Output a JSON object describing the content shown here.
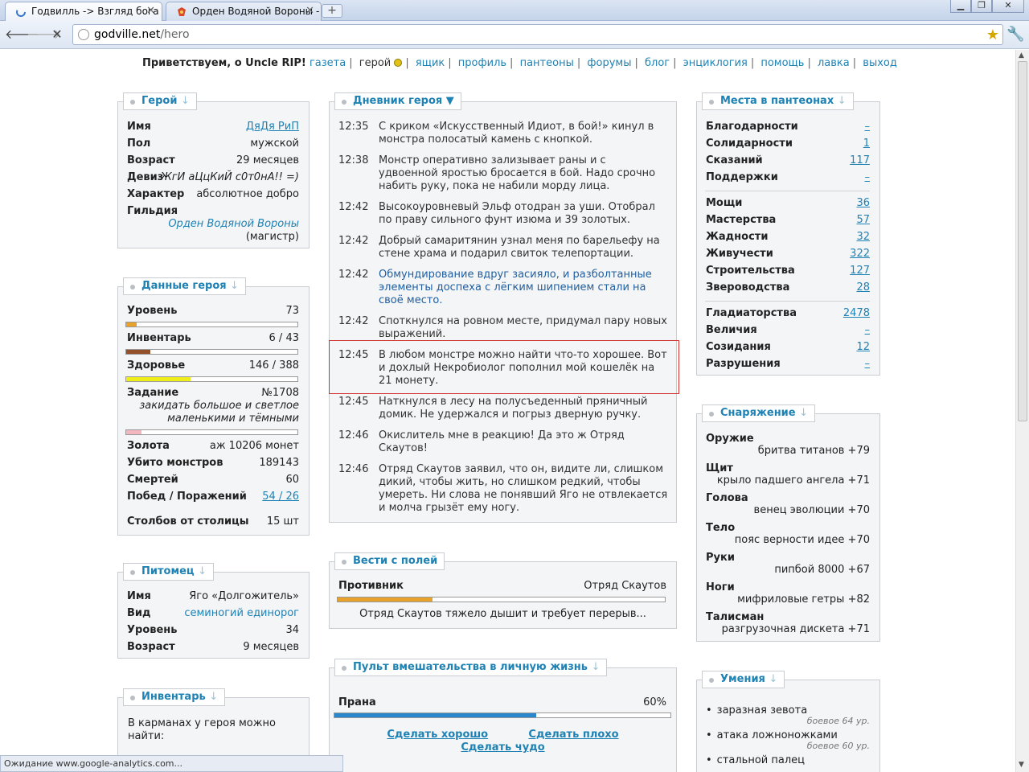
{
  "browser": {
    "tabs": [
      {
        "title": "Годвилль -> Взгляд бога"
      },
      {
        "title": "Орден Водяной Вороны - ..."
      }
    ],
    "url_host": "godville.net",
    "url_path": "/hero",
    "status": "Ожидание www.google-analytics.com..."
  },
  "menu": {
    "greeting": "Приветствуем, о Uncle RIP!",
    "items": [
      "газета",
      "герой",
      "ящик",
      "профиль",
      "пантеоны",
      "форумы",
      "блог",
      "энциклогия",
      "помощь",
      "лавка",
      "выход"
    ]
  },
  "hero": {
    "title": "Герой",
    "rows": [
      {
        "k": "Имя",
        "v": "ДяДя РиП"
      },
      {
        "k": "Пол",
        "v": "мужской"
      },
      {
        "k": "Возраст",
        "v": "29 месяцев"
      },
      {
        "k": "Девиз",
        "v": "ЖгИ аЦцКиЙ с0т0нА!! =)"
      },
      {
        "k": "Характер",
        "v": "абсолютное добро"
      },
      {
        "k": "Гильдия",
        "v": "Орден Водяной Вороны",
        "v2": "(магистр)"
      }
    ]
  },
  "stats": {
    "title": "Данные героя",
    "level_k": "Уровень",
    "level_v": "73",
    "level_pct": 0.06,
    "inv_k": "Инвентарь",
    "inv_v": "6 / 43",
    "inv_pct": 0.14,
    "hp_k": "Здоровье",
    "hp_v": "146 / 388",
    "hp_pct": 0.376,
    "quest_k": "Задание",
    "quest_v": "№1708",
    "quest_text": "закидать большое и светлое маленькими и тёмными",
    "quest_pct": 0.09,
    "gold_k": "Золота",
    "gold_v": "аж 10206 монет",
    "kills_k": "Убито монстров",
    "kills_v": "189143",
    "deaths_k": "Смертей",
    "deaths_v": "60",
    "wins_k": "Побед / Поражений",
    "wins_v": "54 / 26",
    "poles_k": "Столбов от столицы",
    "poles_v": "15 шт"
  },
  "pet": {
    "title": "Питомец",
    "rows": [
      {
        "k": "Имя",
        "v": "Яго «Долгожитель»"
      },
      {
        "k": "Вид",
        "v": "семиногий единорог"
      },
      {
        "k": "Уровень",
        "v": "34"
      },
      {
        "k": "Возраст",
        "v": "9 месяцев"
      }
    ]
  },
  "inventory": {
    "title": "Инвентарь",
    "text": "В карманах у героя можно найти:"
  },
  "diary": {
    "title": "Дневник героя ▼",
    "entries": [
      {
        "t": "12:35",
        "text": "С криком «Искусственный Идиот, в бой!» кинул в монстра полосатый камень с кнопкой."
      },
      {
        "t": "12:38",
        "text": "Монстр оперативно зализывает раны и с удвоенной яростью бросается в бой. Надо срочно набить руку, пока не набили морду лица."
      },
      {
        "t": "12:42",
        "text": "Высокоуровневый Эльф отодран за уши. Отобрал по праву сильного фунт изюма и 39 золотых."
      },
      {
        "t": "12:42",
        "text": "Добрый самаритянин узнал меня по барельефу на стене храма и подарил свиток телепортации."
      },
      {
        "t": "12:42",
        "text": "Обмундирование вдруг засияло, и разболтанные элементы доспеха с лёгким шипением стали на своё место."
      },
      {
        "t": "12:42",
        "text": "Споткнулся на ровном месте, придумал пару новых выражений."
      },
      {
        "t": "12:45",
        "text": "В любом монстре можно найти что-то хорошее. Вот и дохлый Некробиолог пополнил мой кошелёк на 21 монету."
      },
      {
        "t": "12:45",
        "text": "Наткнулся в лесу на полусъеденный пряничный домик. Не удержался и погрыз дверную ручку."
      },
      {
        "t": "12:46",
        "text": "Окислитель мне в реакцию! Да это ж Отряд Скаутов!"
      },
      {
        "t": "12:46",
        "text": "Отряд Скаутов заявил, что он, видите ли, слишком дикий, чтобы жить, но слишком редкий, чтобы умереть. Ни слова не понявший Яго не отвлекается и молча грызёт ему ногу."
      }
    ]
  },
  "news": {
    "title": "Вести с полей",
    "opp_k": "Противник",
    "opp_v": "Отряд Скаутов",
    "opp_pct": 0.29,
    "text": "Отряд Скаутов тяжело дышит и требует перерыв..."
  },
  "remote": {
    "title": "Пульт вмешательства в личную жизнь",
    "prana_k": "Прана",
    "prana_v": "60%",
    "prana_pct": 0.6,
    "good": "Сделать хорошо",
    "bad": "Сделать плохо",
    "miracle": "Сделать чудо"
  },
  "pantheons": {
    "title": "Места в пантеонах",
    "g1": [
      {
        "k": "Благодарности",
        "v": "–"
      },
      {
        "k": "Солидарности",
        "v": "1"
      },
      {
        "k": "Сказаний",
        "v": "117"
      },
      {
        "k": "Поддержки",
        "v": "–"
      }
    ],
    "g2": [
      {
        "k": "Мощи",
        "v": "36"
      },
      {
        "k": "Мастерства",
        "v": "57"
      },
      {
        "k": "Жадности",
        "v": "32"
      },
      {
        "k": "Живучести",
        "v": "322"
      },
      {
        "k": "Строительства",
        "v": "127"
      },
      {
        "k": "Звероводства",
        "v": "28"
      }
    ],
    "g3": [
      {
        "k": "Гладиаторства",
        "v": "2478"
      },
      {
        "k": "Величия",
        "v": "–"
      },
      {
        "k": "Созидания",
        "v": "12"
      },
      {
        "k": "Разрушения",
        "v": "–"
      }
    ]
  },
  "equip": {
    "title": "Снаряжение",
    "items": [
      {
        "k": "Оружие",
        "v": "бритва титанов +79"
      },
      {
        "k": "Щит",
        "v": "крыло падшего ангела +71"
      },
      {
        "k": "Голова",
        "v": "венец эволюции +70"
      },
      {
        "k": "Тело",
        "v": "пояс верности идее +70"
      },
      {
        "k": "Руки",
        "v": "пипбой 8000 +67"
      },
      {
        "k": "Ноги",
        "v": "мифриловые гетры +82"
      },
      {
        "k": "Талисман",
        "v": "разгрузочная дискета +71"
      }
    ]
  },
  "skills": {
    "title": "Умения",
    "items": [
      {
        "name": "заразная зевота",
        "lvl": "боевое 64 ур."
      },
      {
        "name": "атака ложноножками",
        "lvl": "боевое 60 ур."
      },
      {
        "name": "стальной палец",
        "lvl": ""
      }
    ]
  }
}
